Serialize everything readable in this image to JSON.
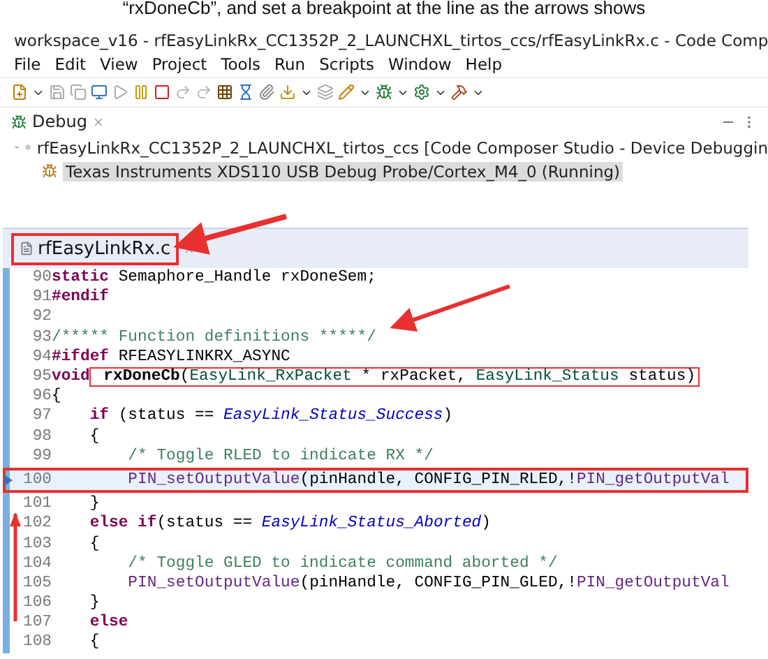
{
  "caption": "“rxDoneCb”, and set a breakpoint at the line as the arrows shows",
  "window": {
    "title": "workspace_v16 - rfEasyLinkRx_CC1352P_2_LAUNCHXL_tirtos_ccs/rfEasyLinkRx.c - Code Comp"
  },
  "menu": [
    "File",
    "Edit",
    "View",
    "Project",
    "Tools",
    "Run",
    "Scripts",
    "Window",
    "Help"
  ],
  "debug_view": {
    "tab": "Debug",
    "tree": [
      {
        "label": "rfEasyLinkRx_CC1352P_2_LAUNCHXL_tirtos_ccs [Code Composer Studio - Device Debuggin",
        "expanded": true,
        "selected": false,
        "children": [
          {
            "label": "Texas Instruments XDS110 USB Debug Probe/Cortex_M4_0 (Running)",
            "selected": true
          }
        ]
      }
    ]
  },
  "editor": {
    "tab": "rfEasyLinkRx.c",
    "tab_boxed": true,
    "lines": [
      {
        "number": "90",
        "current": false,
        "tokens": [
          {
            "kind": "kw",
            "text": "static"
          },
          {
            "kind": "plain",
            "text": " Semaphore_Handle rxDoneSem;"
          }
        ]
      },
      {
        "number": "91",
        "current": false,
        "tokens": [
          {
            "kind": "kw",
            "text": "#endif"
          }
        ]
      },
      {
        "number": "92",
        "current": false
      },
      {
        "number": "93",
        "current": false,
        "tokens": [
          {
            "kind": "comment",
            "text": "/***** Function definitions *****/"
          }
        ]
      },
      {
        "number": "94",
        "current": false,
        "tokens": [
          {
            "kind": "kw",
            "text": "#ifdef"
          },
          {
            "kind": "plain",
            "text": " RFEASYLINKRX_ASYNC"
          }
        ]
      },
      {
        "number": "95",
        "current": false,
        "tokens": [
          {
            "kind": "kw",
            "text": "void"
          }
        ],
        "boxed_tokens": [
          {
            "kind": "name",
            "text": " rxDoneCb"
          },
          {
            "kind": "plain",
            "text": "("
          },
          {
            "kind": "type",
            "text": "EasyLink_RxPacket"
          },
          {
            "kind": "plain",
            "text": " * rxPacket, "
          },
          {
            "kind": "type",
            "text": "EasyLink_Status"
          },
          {
            "kind": "plain",
            "text": " status)"
          }
        ]
      },
      {
        "number": "96",
        "current": false,
        "tokens": [
          {
            "kind": "plain",
            "text": "{"
          }
        ]
      },
      {
        "number": "97",
        "current": false,
        "tokens": [
          {
            "kind": "kw",
            "text": "    if"
          },
          {
            "kind": "plain",
            "text": " (status == "
          },
          {
            "kind": "enum",
            "text": "EasyLink_Status_Success"
          },
          {
            "kind": "plain",
            "text": ")"
          }
        ]
      },
      {
        "number": "98",
        "current": false,
        "tokens": [
          {
            "kind": "plain",
            "text": "    {"
          }
        ]
      },
      {
        "number": "99",
        "current": false,
        "tokens": [
          {
            "kind": "comment",
            "text": "        /* Toggle RLED to indicate RX */"
          }
        ]
      },
      {
        "number": "100",
        "current": true,
        "breakpoint": true,
        "boxed": true,
        "tokens": [
          {
            "kind": "fn",
            "text": "        PIN_setOutputValue"
          },
          {
            "kind": "plain",
            "text": "(pinHandle, CONFIG_PIN_RLED,!"
          },
          {
            "kind": "fn",
            "text": "PIN_getOutputVal"
          }
        ]
      },
      {
        "number": "101",
        "current": false,
        "tokens": [
          {
            "kind": "plain",
            "text": "    }"
          }
        ]
      },
      {
        "number": "102",
        "current": false,
        "tokens": [
          {
            "kind": "kw",
            "text": "    else if"
          },
          {
            "kind": "plain",
            "text": "(status == "
          },
          {
            "kind": "enum",
            "text": "EasyLink_Status_Aborted"
          },
          {
            "kind": "plain",
            "text": ")"
          }
        ]
      },
      {
        "number": "103",
        "current": false,
        "tokens": [
          {
            "kind": "plain",
            "text": "    {"
          }
        ]
      },
      {
        "number": "104",
        "current": false,
        "tokens": [
          {
            "kind": "comment",
            "text": "        /* Toggle GLED to indicate command aborted */"
          }
        ]
      },
      {
        "number": "105",
        "current": false,
        "tokens": [
          {
            "kind": "fn",
            "text": "        PIN_setOutputValue"
          },
          {
            "kind": "plain",
            "text": "(pinHandle, CONFIG_PIN_GLED,!"
          },
          {
            "kind": "fn",
            "text": "PIN_getOutputVal"
          }
        ]
      },
      {
        "number": "106",
        "current": false,
        "tokens": [
          {
            "kind": "plain",
            "text": "    }"
          }
        ]
      },
      {
        "number": "107",
        "current": false,
        "tokens": [
          {
            "kind": "kw",
            "text": "    else"
          }
        ]
      },
      {
        "number": "108",
        "current": false,
        "tokens": [
          {
            "kind": "plain",
            "text": "    {"
          }
        ]
      }
    ]
  }
}
